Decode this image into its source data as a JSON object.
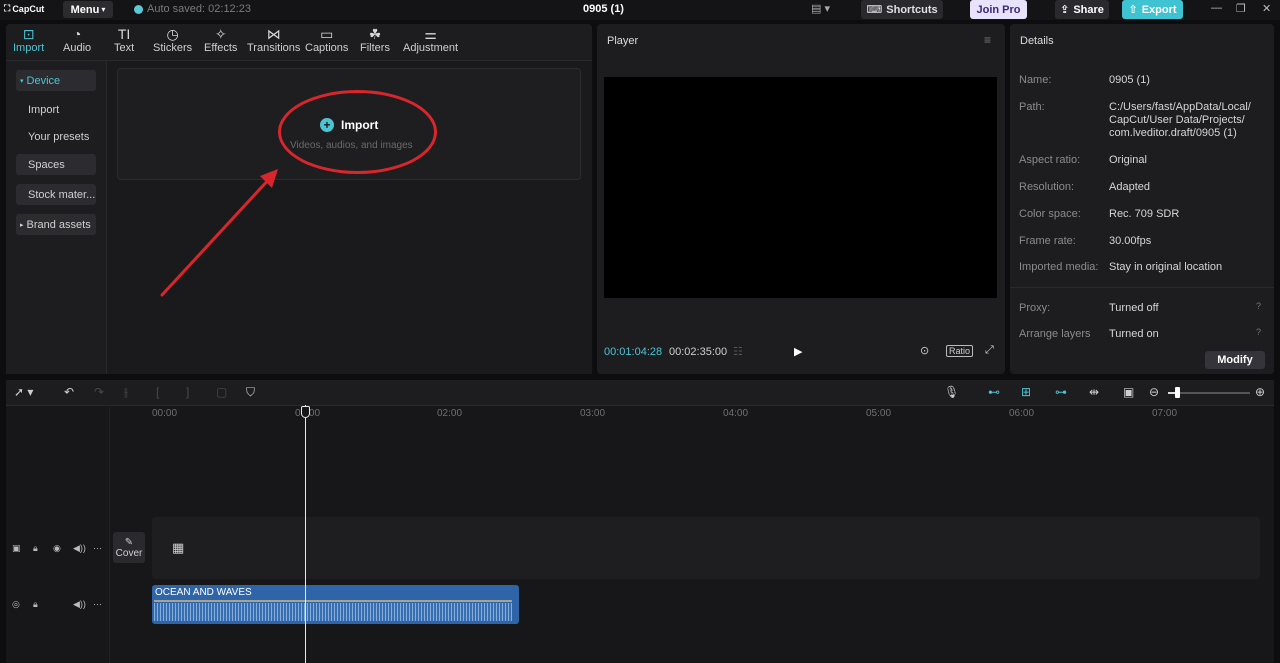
{
  "titlebar": {
    "logo": "CapCut",
    "menu_label": "Menu",
    "autosave": "Auto saved: 02:12:23",
    "project_title": "0905 (1)",
    "shortcuts_label": "Shortcuts",
    "joinpro_label": "Join Pro",
    "share_label": "Share",
    "export_label": "Export"
  },
  "tools": [
    {
      "label": "Import",
      "icon": "import-icon"
    },
    {
      "label": "Audio",
      "icon": "audio-icon"
    },
    {
      "label": "Text",
      "icon": "text-icon"
    },
    {
      "label": "Stickers",
      "icon": "stickers-icon"
    },
    {
      "label": "Effects",
      "icon": "effects-icon"
    },
    {
      "label": "Transitions",
      "icon": "transitions-icon"
    },
    {
      "label": "Captions",
      "icon": "captions-icon"
    },
    {
      "label": "Filters",
      "icon": "filters-icon"
    },
    {
      "label": "Adjustment",
      "icon": "adjustment-icon"
    }
  ],
  "sidebar": {
    "device": "Device",
    "import": "Import",
    "presets": "Your presets",
    "spaces": "Spaces",
    "stock": "Stock mater...",
    "brand": "Brand assets"
  },
  "media": {
    "import_label": "Import",
    "import_sub": "Videos, audios, and images"
  },
  "player": {
    "title": "Player",
    "current_time": "00:01:04:28",
    "total_time": "00:02:35:00",
    "ratio_label": "Ratio"
  },
  "details": {
    "title": "Details",
    "name_label": "Name:",
    "name_value": "0905 (1)",
    "path_label": "Path:",
    "path_value_1": "C:/Users/fast/AppData/Local/",
    "path_value_2": "CapCut/User Data/Projects/",
    "path_value_3": "com.lveditor.draft/0905 (1)",
    "aspect_label": "Aspect ratio:",
    "aspect_value": "Original",
    "resolution_label": "Resolution:",
    "resolution_value": "Adapted",
    "color_label": "Color space:",
    "color_value": "Rec. 709 SDR",
    "fps_label": "Frame rate:",
    "fps_value": "30.00fps",
    "imported_label": "Imported media:",
    "imported_value": "Stay in original location",
    "proxy_label": "Proxy:",
    "proxy_value": "Turned off",
    "arrange_label": "Arrange layers",
    "arrange_value": "Turned on",
    "modify_label": "Modify"
  },
  "timeline": {
    "ruler": [
      "00:00",
      "01:00",
      "02:00",
      "03:00",
      "04:00",
      "05:00",
      "06:00",
      "07:00"
    ],
    "cover_label": "Cover",
    "audio_clip_label": "OCEAN AND WAVES"
  },
  "colors": {
    "accent": "#4cc4d4",
    "annotation_red": "#d8262c",
    "audio_clip": "#2f64a8"
  }
}
